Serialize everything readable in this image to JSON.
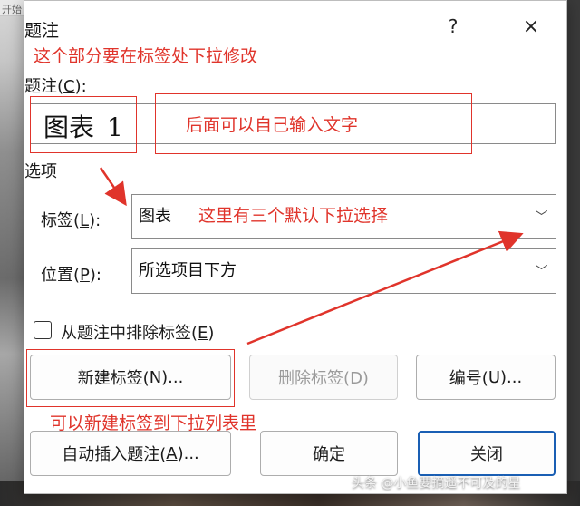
{
  "background": {
    "app_tab_text": "开始 工"
  },
  "dialog": {
    "title": "题注",
    "help_label": "?",
    "close_label": "×",
    "caption": {
      "label_prefix": "题注(",
      "label_key": "C",
      "label_suffix": "):",
      "value_text": "图表",
      "value_number": "1"
    },
    "options_group": "选项",
    "label_field": {
      "label_prefix": "标签(",
      "label_key": "L",
      "label_suffix": "):",
      "selected": "图表",
      "chevron": "﹀"
    },
    "position_field": {
      "label_prefix": "位置(",
      "label_key": "P",
      "label_suffix": "):",
      "selected": "所选项目下方",
      "chevron": "﹀"
    },
    "exclude_label": {
      "prefix": "从题注中排除标签(",
      "key": "E",
      "suffix": ")",
      "checked": false
    },
    "buttons": {
      "new_label": {
        "prefix": "新建标签(",
        "key": "N",
        "suffix": ")..."
      },
      "delete_label": {
        "text": "删除标签(D)"
      },
      "numbering": {
        "prefix": "编号(",
        "key": "U",
        "suffix": ")..."
      },
      "autocaption": {
        "prefix": "自动插入题注(",
        "key": "A",
        "suffix": ")..."
      },
      "ok": {
        "text": "确定"
      },
      "close": {
        "text": "关闭"
      }
    }
  },
  "annotations": {
    "top_note": "这个部分要在标签处下拉修改",
    "input_note": "后面可以自己输入文字",
    "dropdown_note": "这里有三个默认下拉选择",
    "newlabel_note": "可以新建标签到下拉列表里",
    "color": "#e0342b"
  },
  "watermark": "头条 @小鱼要摘遥不可及的星"
}
